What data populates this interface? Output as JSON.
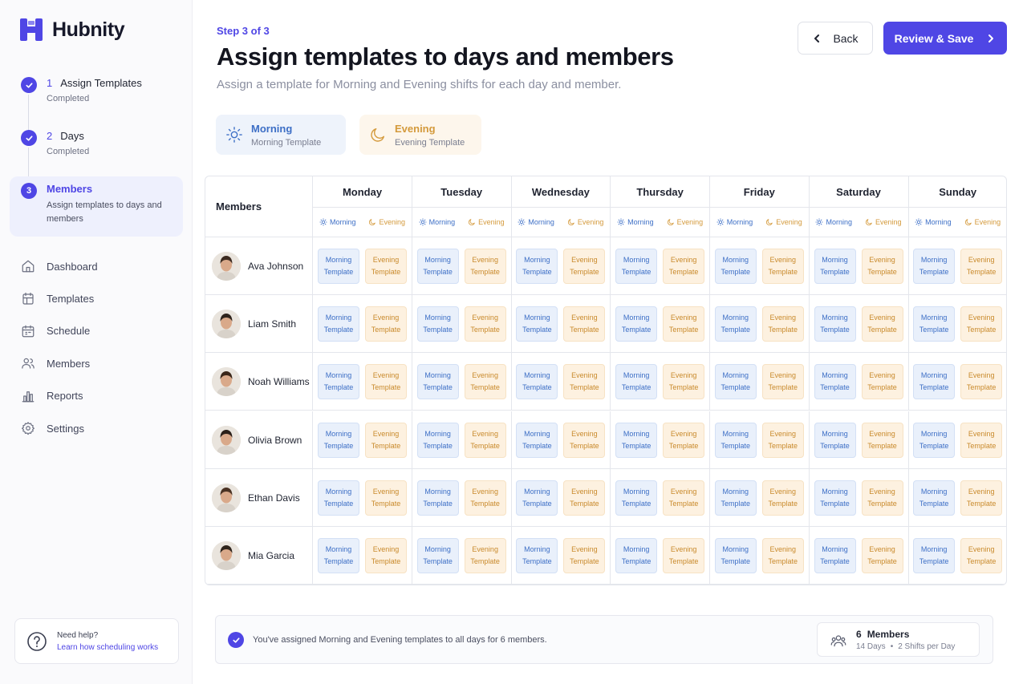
{
  "app": {
    "name": "Hubnity",
    "accent": "#4f46e5"
  },
  "steps": [
    {
      "num": "1",
      "title": "Assign Templates",
      "status": "Completed"
    },
    {
      "num": "2",
      "title": "Days",
      "status": "Completed"
    },
    {
      "num": "3",
      "title": "Members",
      "status": "Assign templates to days and members"
    }
  ],
  "nav": [
    {
      "label": "Dashboard",
      "icon": "home-icon"
    },
    {
      "label": "Templates",
      "icon": "templates-icon"
    },
    {
      "label": "Schedule",
      "icon": "calendar-icon"
    },
    {
      "label": "Members",
      "icon": "users-icon"
    },
    {
      "label": "Reports",
      "icon": "bar-chart-icon"
    },
    {
      "label": "Settings",
      "icon": "gear-icon"
    }
  ],
  "help": {
    "title": "Need help?",
    "link": "Learn how scheduling works"
  },
  "header": {
    "step_label": "Step 3 of 3",
    "title": "Assign templates to days and members",
    "subtitle": "Assign a template for Morning and Evening shifts for each day and member.",
    "back_label": "Back",
    "save_label": "Review & Save"
  },
  "legend": {
    "morning": {
      "title": "Morning",
      "sub": "Morning Template"
    },
    "evening": {
      "title": "Evening",
      "sub": "Evening Template"
    }
  },
  "grid": {
    "members_header": "Members",
    "shift_morning": "Morning",
    "shift_evening": "Evening",
    "days": [
      "Monday",
      "Tuesday",
      "Wednesday",
      "Thursday",
      "Friday",
      "Saturday",
      "Sunday"
    ],
    "members": [
      "Ava Johnson",
      "Liam Smith",
      "Noah Williams",
      "Olivia Brown",
      "Ethan Davis",
      "Mia Garcia"
    ],
    "chip_morning": [
      "Morning",
      "Template"
    ],
    "chip_evening": [
      "Evening",
      "Template"
    ]
  },
  "summary": {
    "message": "You've assigned Morning and Evening templates to all days for 6 members.",
    "count": "6",
    "count_label": "Members",
    "days": "14 Days",
    "shifts": "2 Shifts per Day"
  }
}
